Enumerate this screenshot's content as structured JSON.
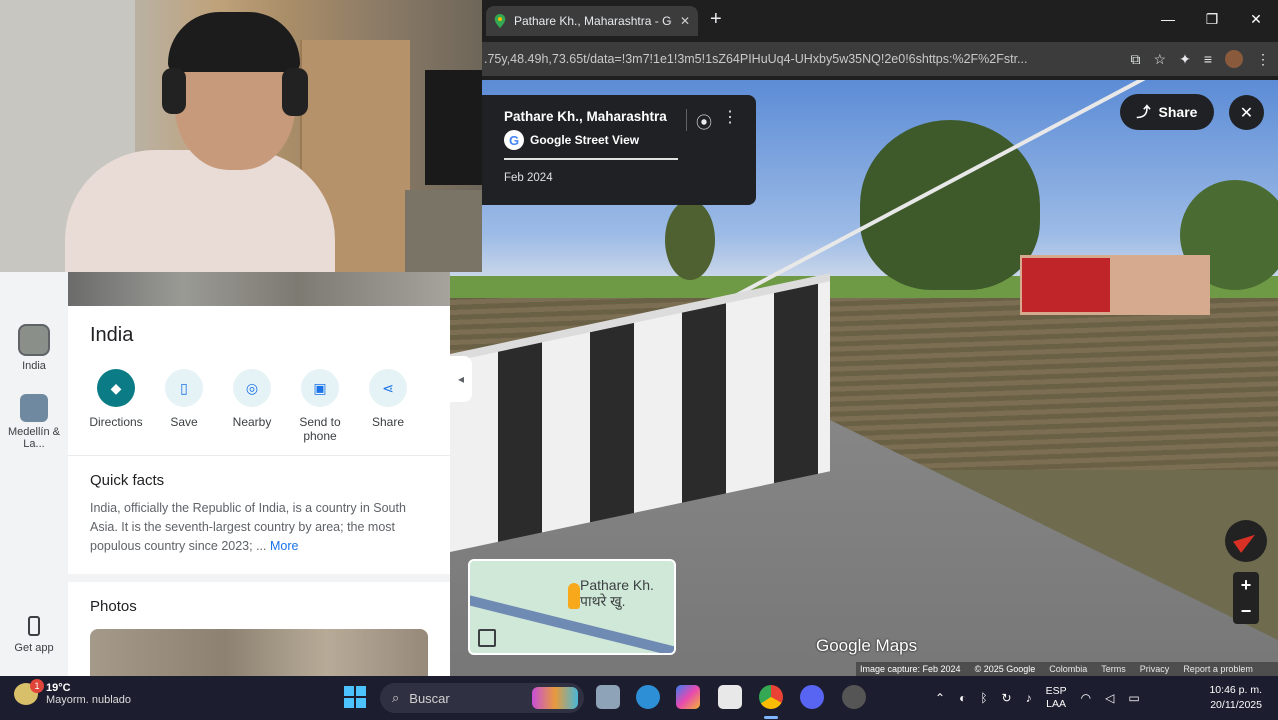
{
  "browser": {
    "tab_title": "Pathare Kh., Maharashtra - Google",
    "url": ".75y,48.49h,73.65t/data=!3m7!1e1!3m5!1sZ64PIHuUq4-UHxby5w35NQ!2e0!6shttps:%2F%2Fstr..."
  },
  "streetview": {
    "place_title": "Pathare Kh., Maharashtra",
    "source_label": "Google Street View",
    "capture_date": "Feb 2024",
    "share_label": "Share",
    "minimap_label_line1": "Pathare Kh.",
    "minimap_label_line2": "पाथरे खु.",
    "logo_text": "Google Maps",
    "attribution": {
      "capture": "Image capture: Feb 2024",
      "copyright": "© 2025 Google",
      "region": "Colombia",
      "terms": "Terms",
      "privacy": "Privacy",
      "report": "Report a problem"
    }
  },
  "rail": {
    "item1": "India",
    "item2": "Medellín & La...",
    "get_app": "Get app"
  },
  "panel": {
    "title": "India",
    "actions": [
      {
        "label": "Directions",
        "icon": "directions-icon"
      },
      {
        "label": "Save",
        "icon": "bookmark-icon"
      },
      {
        "label": "Nearby",
        "icon": "nearby-icon"
      },
      {
        "label": "Send to phone",
        "icon": "send-to-phone-icon"
      },
      {
        "label": "Share",
        "icon": "share-icon"
      }
    ],
    "quick_facts_title": "Quick facts",
    "quick_facts_text": "India, officially the Republic of India, is a country in South Asia. It is the seventh-largest country by area; the most populous country since 2023; ... ",
    "more_label": "More",
    "photos_title": "Photos"
  },
  "taskbar": {
    "temp": "19°C",
    "weather": "Mayorm. nublado",
    "weather_badge": "1",
    "search_placeholder": "Buscar",
    "lang1": "ESP",
    "lang2": "LAA",
    "time": "10:46 p. m.",
    "date": "20/11/2025"
  },
  "colors": {
    "accent": "#0b7c86",
    "link": "#1a73e8",
    "taskbar": "#1c1d2e"
  }
}
